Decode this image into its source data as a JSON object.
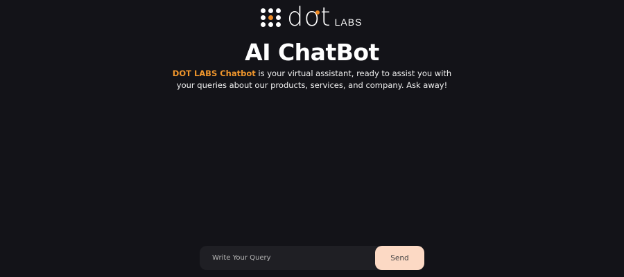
{
  "logo": {
    "wordmark": "dot",
    "suffix": "LABS",
    "accent_color": "#f08a24"
  },
  "header": {
    "title": "AI ChatBot"
  },
  "intro": {
    "brand": "DOT LABS Chatbot",
    "text": " is your virtual assistant, ready to assist you with your queries about our products, services, and company. Ask away!",
    "brand_color": "#f0962c"
  },
  "query": {
    "placeholder": "Write Your Query",
    "value": "",
    "send_label": "Send",
    "send_color": "#fcd9c4"
  },
  "background_color": "#131318"
}
